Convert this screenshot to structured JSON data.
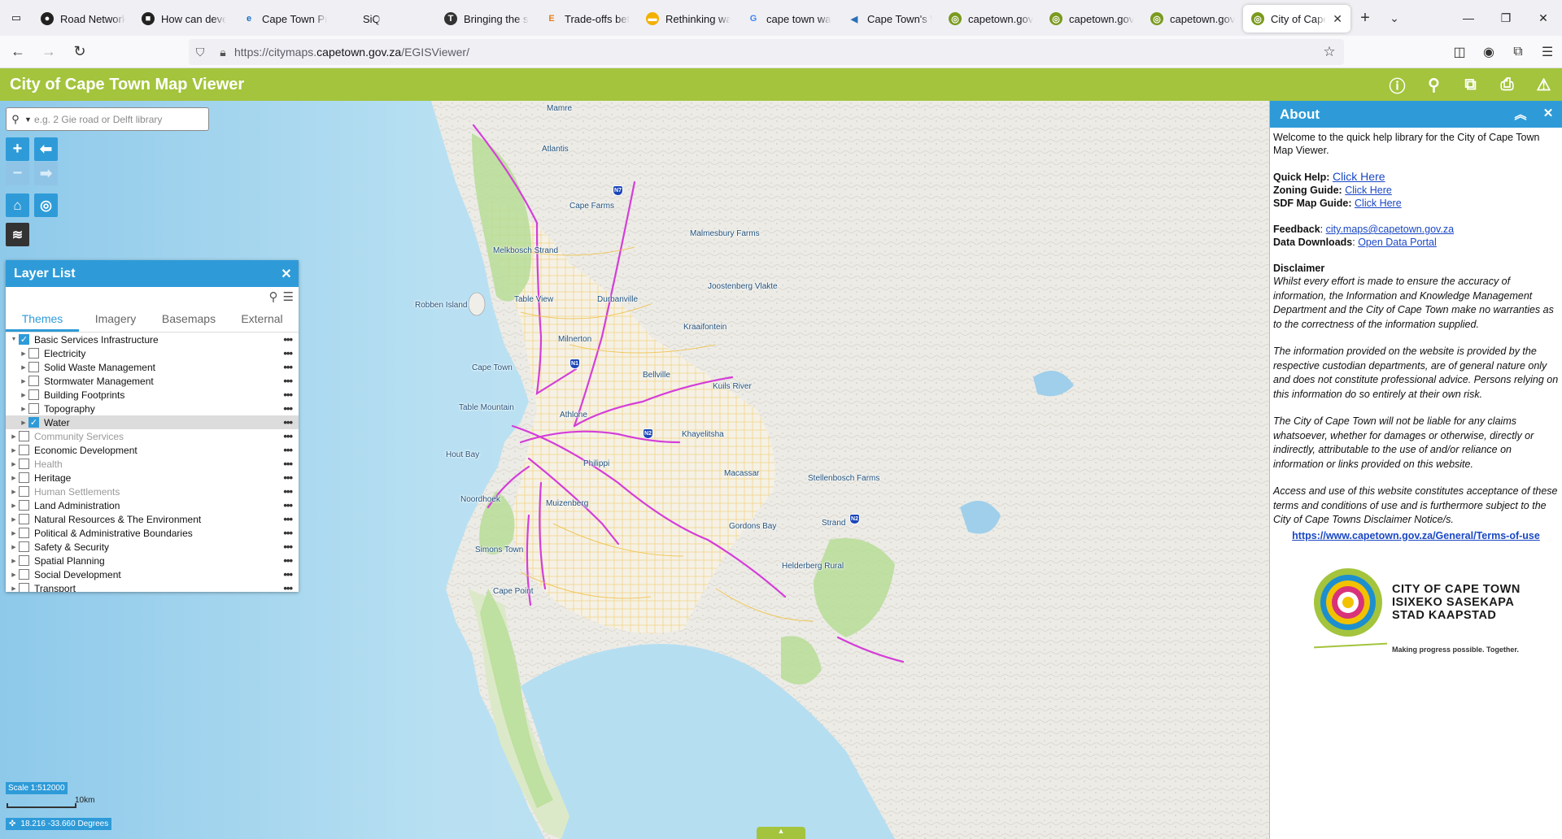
{
  "browser": {
    "tabs": [
      {
        "label": "Road Networks",
        "icon": "github-icon",
        "color": "#222222",
        "glyph": "●"
      },
      {
        "label": "How can develo",
        "icon": "academia-icon",
        "color": "#222222",
        "glyph": "■"
      },
      {
        "label": "Cape Town Pro",
        "icon": "esri-icon",
        "color": "#1a6fc4",
        "glyph": "e"
      },
      {
        "label": "SiQ",
        "icon": "siq-icon",
        "color": "#ffffff",
        "glyph": ""
      },
      {
        "label": "Bringing the so",
        "icon": "t-icon",
        "color": "#333333",
        "glyph": "T"
      },
      {
        "label": "Trade-offs betw",
        "icon": "elsevier-icon",
        "color": "#e8801a",
        "glyph": "E"
      },
      {
        "label": "Rethinking wat",
        "icon": "folder-icon",
        "color": "#f2b000",
        "glyph": "▬"
      },
      {
        "label": "cape town wate",
        "icon": "google-icon",
        "color": "#4285f4",
        "glyph": "G"
      },
      {
        "label": "Cape Town's W",
        "icon": "bird-icon",
        "color": "#2a6fb8",
        "glyph": "◀"
      },
      {
        "label": "capetown.gov.z",
        "icon": "capetown-icon",
        "color": "#7a9a1e",
        "glyph": "◎"
      },
      {
        "label": "capetown.gov.z",
        "icon": "capetown-icon",
        "color": "#7a9a1e",
        "glyph": "◎"
      },
      {
        "label": "capetown.gov.z",
        "icon": "capetown-icon",
        "color": "#7a9a1e",
        "glyph": "◎"
      },
      {
        "label": "City of Cape",
        "icon": "capetown-icon",
        "color": "#7a9a1e",
        "glyph": "◎",
        "active": true
      }
    ],
    "url_prefix": "https://citymaps.",
    "url_domain": "capetown.gov.za",
    "url_path": "/EGISViewer/"
  },
  "app": {
    "title": "City of Cape Town Map Viewer",
    "search_placeholder": "e.g. 2 Gie road or Delft library"
  },
  "layer_list": {
    "title": "Layer List",
    "tabs": [
      {
        "label": "Themes",
        "active": true
      },
      {
        "label": "Imagery"
      },
      {
        "label": "Basemaps"
      },
      {
        "label": "External"
      }
    ],
    "rows": [
      {
        "label": "Basic Services Infrastructure",
        "level": 0,
        "checked": true,
        "expanded": true
      },
      {
        "label": "Electricity",
        "level": 1,
        "checked": false
      },
      {
        "label": "Solid Waste Management",
        "level": 1,
        "checked": false
      },
      {
        "label": "Stormwater Management",
        "level": 1,
        "checked": false
      },
      {
        "label": "Building Footprints",
        "level": 1,
        "checked": false
      },
      {
        "label": "Topography",
        "level": 1,
        "checked": false
      },
      {
        "label": "Water",
        "level": 1,
        "checked": true,
        "selected": true
      },
      {
        "label": "Community Services",
        "level": 0,
        "checked": false,
        "grey": true
      },
      {
        "label": "Economic Development",
        "level": 0,
        "checked": false
      },
      {
        "label": "Health",
        "level": 0,
        "checked": false,
        "grey": true
      },
      {
        "label": "Heritage",
        "level": 0,
        "checked": false
      },
      {
        "label": "Human Settlements",
        "level": 0,
        "checked": false,
        "grey": true
      },
      {
        "label": "Land Administration",
        "level": 0,
        "checked": false
      },
      {
        "label": "Natural Resources & The Environment",
        "level": 0,
        "checked": false
      },
      {
        "label": "Political & Administrative Boundaries",
        "level": 0,
        "checked": false
      },
      {
        "label": "Safety & Security",
        "level": 0,
        "checked": false
      },
      {
        "label": "Spatial Planning",
        "level": 0,
        "checked": false
      },
      {
        "label": "Social Development",
        "level": 0,
        "checked": false
      },
      {
        "label": "Transport",
        "level": 0,
        "checked": false
      }
    ]
  },
  "map": {
    "places": [
      {
        "name": "Mamre"
      },
      {
        "name": "Atlantis"
      },
      {
        "name": "Cape Farms"
      },
      {
        "name": "Malmesbury Farms"
      },
      {
        "name": "Melkbosch Strand"
      },
      {
        "name": "Joostenberg Vlakte"
      },
      {
        "name": "Robben Island"
      },
      {
        "name": "Table View"
      },
      {
        "name": "Durbanville"
      },
      {
        "name": "Kraaifontein"
      },
      {
        "name": "Milnerton"
      },
      {
        "name": "Cape Town"
      },
      {
        "name": "Bellville"
      },
      {
        "name": "Kuils River"
      },
      {
        "name": "Table Mountain"
      },
      {
        "name": "Athlone"
      },
      {
        "name": "Khayelitsha"
      },
      {
        "name": "Hout Bay"
      },
      {
        "name": "Philippi"
      },
      {
        "name": "Macassar"
      },
      {
        "name": "Stellenbosch Farms"
      },
      {
        "name": "Noordhoek"
      },
      {
        "name": "Muizenberg"
      },
      {
        "name": "Gordons Bay"
      },
      {
        "name": "Strand"
      },
      {
        "name": "Simons Town"
      },
      {
        "name": "Helderberg Rural"
      },
      {
        "name": "Cape Point"
      }
    ],
    "shields": [
      {
        "label": "N7"
      },
      {
        "label": "N1"
      },
      {
        "label": "N2"
      },
      {
        "label": "N2"
      }
    ],
    "scale": "Scale 1:512000",
    "scale_bar_label": "10km",
    "coords": "18.216 -33.660 Degrees"
  },
  "about": {
    "title": "About",
    "intro": "Welcome to the quick help library for the City of Cape Town Map Viewer.",
    "quick_help_label": "Quick Help:",
    "quick_help_link": "Click Here",
    "zoning_label": "Zoning Guide:",
    "zoning_link": "Click Here",
    "sdf_label": "SDF Map Guide:",
    "sdf_link": "Click Here",
    "feedback_label": "Feedback",
    "feedback_email": "city.maps@capetown.gov.za",
    "downloads_label": "Data Downloads",
    "downloads_link": "Open Data Portal",
    "disclaimer_title": "Disclaimer",
    "disclaimer_1": "Whilst every effort is made to ensure the accuracy of information, the Information and Knowledge Management Department and the City of Cape Town make no warranties as to the correctness of the information supplied.",
    "disclaimer_2": "The information provided on the website is provided by the respective custodian departments, are of general nature only and does not constitute professional advice. Persons relying on this information do so entirely at their own risk.",
    "disclaimer_3": "The City of Cape Town will not be liable for any claims whatsoever, whether for damages or otherwise, directly or indirectly, attributable to the use of and/or reliance on information or links provided on this website.",
    "disclaimer_4": "Access and use of this website constitutes acceptance of these terms and conditions of use and is furthermore subject to the City of Cape Towns Disclaimer Notice/s.",
    "terms_link": "https://www.capetown.gov.za/General/Terms-of-use",
    "logo_line1": "CITY OF CAPE TOWN",
    "logo_line2": "ISIXEKO SASEKAPA",
    "logo_line3": "STAD KAAPSTAD",
    "slogan": "Making progress possible. Together."
  },
  "colors": {
    "header_green": "#a3c43c",
    "panel_blue": "#2e9bd8",
    "link_blue": "#1a47c4",
    "route_magenta": "#d43ed8"
  }
}
